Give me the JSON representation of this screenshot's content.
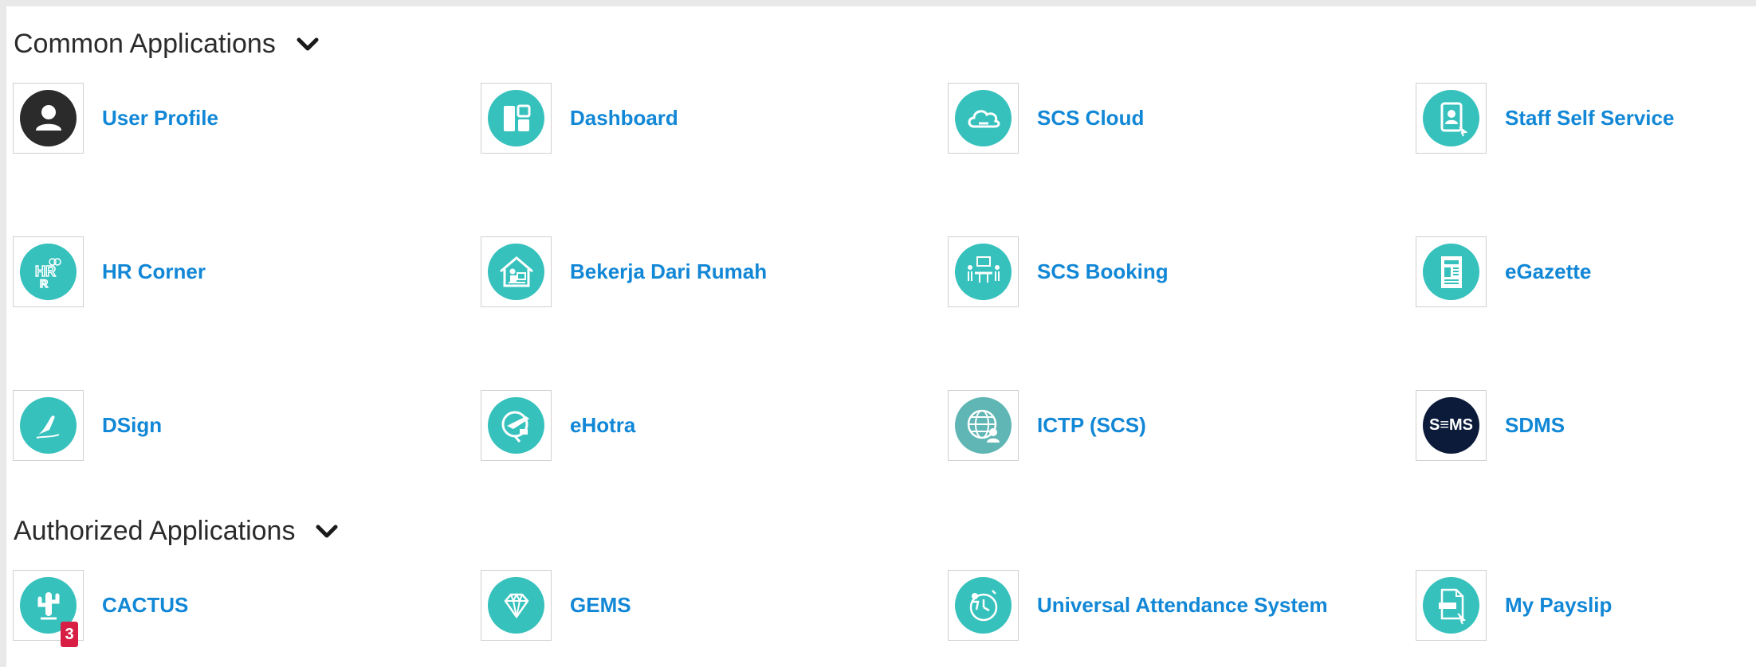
{
  "sections": [
    {
      "title": "Common Applications",
      "icon": "chevron-down-icon"
    },
    {
      "title": "Authorized Applications",
      "icon": "chevron-down-icon"
    }
  ],
  "apps": [
    {
      "label": "User Profile",
      "icon": "user-icon",
      "color": "#2b2b2b"
    },
    {
      "label": "Dashboard",
      "icon": "dashboard-icon",
      "color": "#36c1bd"
    },
    {
      "label": "SCS Cloud",
      "icon": "cloud-icon",
      "color": "#36c1bd"
    },
    {
      "label": "Staff Self Service",
      "icon": "staff-id-icon",
      "color": "#36c1bd"
    },
    {
      "label": "HR Corner",
      "icon": "hr-icon",
      "color": "#36c1bd"
    },
    {
      "label": "Bekerja Dari Rumah",
      "icon": "home-work-icon",
      "color": "#36c1bd"
    },
    {
      "label": "SCS Booking",
      "icon": "meeting-icon",
      "color": "#36c1bd"
    },
    {
      "label": "eGazette",
      "icon": "document-icon",
      "color": "#36c1bd"
    },
    {
      "label": "DSign",
      "icon": "signature-icon",
      "color": "#36c1bd"
    },
    {
      "label": "eHotra",
      "icon": "plane-icon",
      "color": "#36c1bd"
    },
    {
      "label": "ICTP (SCS)",
      "icon": "globe-user-icon",
      "color": "#5fb6b4"
    },
    {
      "label": "SDMS",
      "icon": "sdms-logo",
      "color": "#0c1b3a",
      "logo_text": "S≡MS"
    },
    {
      "label": "CACTUS",
      "icon": "cactus-icon",
      "color": "#36c1bd",
      "badge": "3"
    },
    {
      "label": "GEMS",
      "icon": "diamond-icon",
      "color": "#36c1bd"
    },
    {
      "label": "Universal Attendance System",
      "icon": "attendance-icon",
      "color": "#36c1bd"
    },
    {
      "label": "My Payslip",
      "icon": "payslip-icon",
      "color": "#36c1bd"
    }
  ],
  "colors": {
    "accent": "#1187d6",
    "icon_teal": "#36c1bd",
    "badge": "#d81e45"
  }
}
